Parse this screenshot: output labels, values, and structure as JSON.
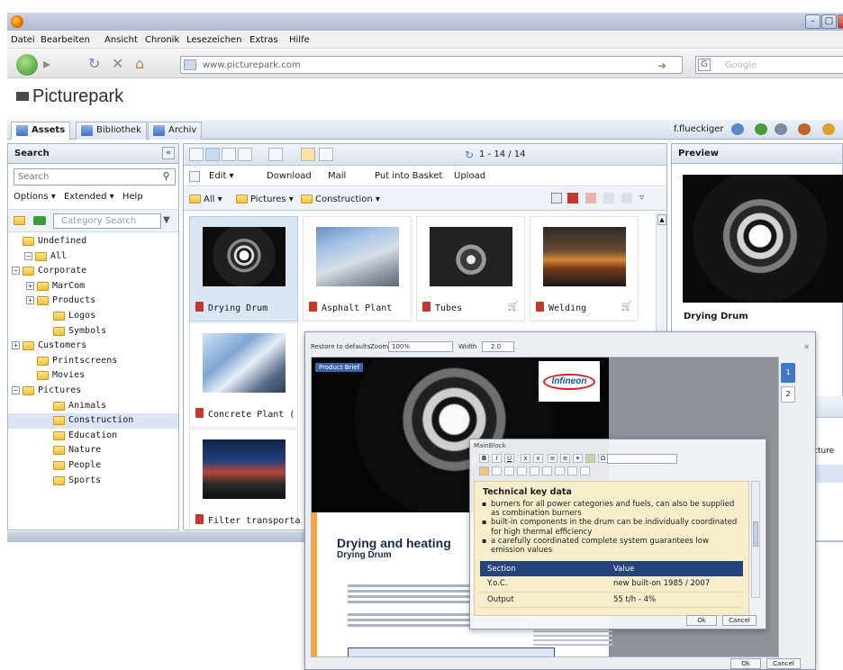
{
  "browser": {
    "menu": [
      "Datei",
      "Bearbeiten",
      "Ansicht",
      "Chronik",
      "Lesezeichen",
      "Extras",
      "Hilfe"
    ],
    "url": "www.picturepark.com",
    "search_engine": "Google"
  },
  "app": {
    "logo_text": "Picturepark",
    "tabs": [
      "Assets",
      "Bibliothek",
      "Archiv"
    ],
    "user": "f.flueckiger"
  },
  "left": {
    "title": "Search",
    "search_placeholder": "Search",
    "options": [
      "Options ▾",
      "Extended ▾",
      "Help"
    ],
    "category_placeholder": "Category Search",
    "tree": [
      {
        "label": "Undefined",
        "depth": 1,
        "toggle": ""
      },
      {
        "label": "All",
        "depth": 0,
        "toggle": "−",
        "open": true
      },
      {
        "label": "Corporate",
        "depth": 1,
        "toggle": "−",
        "open": true
      },
      {
        "label": "MarCom",
        "depth": 2,
        "toggle": "+"
      },
      {
        "label": "Products",
        "depth": 2,
        "toggle": "+"
      },
      {
        "label": "Logos",
        "depth": 3,
        "toggle": ""
      },
      {
        "label": "Symbols",
        "depth": 3,
        "toggle": ""
      },
      {
        "label": "Customers",
        "depth": 1,
        "toggle": "+"
      },
      {
        "label": "Printscreens",
        "depth": 2,
        "toggle": ""
      },
      {
        "label": "Movies",
        "depth": 2,
        "toggle": ""
      },
      {
        "label": "Pictures",
        "depth": 1,
        "toggle": "−",
        "open": true
      },
      {
        "label": "Animals",
        "depth": 3,
        "toggle": ""
      },
      {
        "label": "Construction",
        "depth": 3,
        "toggle": "",
        "selected": true
      },
      {
        "label": "Education",
        "depth": 3,
        "toggle": ""
      },
      {
        "label": "Nature",
        "depth": 3,
        "toggle": ""
      },
      {
        "label": "People",
        "depth": 3,
        "toggle": ""
      },
      {
        "label": "Sports",
        "depth": 3,
        "toggle": ""
      }
    ]
  },
  "center": {
    "paging": "1 - 14 / 14",
    "actions": [
      "Edit ▾",
      "Download",
      "Mail",
      "Put into Basket",
      "Upload"
    ],
    "crumbs": [
      "All ▾",
      "Pictures ▾",
      "Construction ▾"
    ],
    "assets": [
      {
        "label": "Drying Drum",
        "thumb": "drum",
        "selected": true,
        "cart": false
      },
      {
        "label": "Asphalt Plant",
        "thumb": "asphalt",
        "selected": false,
        "cart": false
      },
      {
        "label": "Tubes",
        "thumb": "tubes",
        "selected": false,
        "cart": true
      },
      {
        "label": "Welding",
        "thumb": "welding",
        "selected": false,
        "cart": true
      },
      {
        "label": "Concrete Plant (",
        "thumb": "concrete",
        "selected": false,
        "cart": false
      },
      {
        "label": "Filter transporta",
        "thumb": "filter",
        "selected": false,
        "cart": false
      }
    ]
  },
  "preview": {
    "title": "Preview",
    "asset_title": "Drying Drum"
  },
  "overlay": {
    "restore_label": "Restore to defaults",
    "zoom_label": "Zoom",
    "zoom_value": "100%",
    "width_label": "Width",
    "width_value": "2.0",
    "product_brief": "Product Brief",
    "brand": "Infineon",
    "doc_title": "Drying and heating",
    "doc_subtitle": "Drying Drum",
    "ok": "Ok",
    "cancel": "Cancel",
    "behind_text": "cture"
  },
  "keydata": {
    "window_title": "MainBlock",
    "heading": "Technical key data",
    "bullets": [
      "burners for all power categories and fuels, can also be supplied as combination burners",
      "built-in components in the drum can be individually coordinated for high thermal efficiency",
      "a carefully coordinated complete system guarantees low emission values"
    ],
    "table_header": [
      "Section",
      "Value"
    ],
    "rows": [
      [
        "Y.o.C.",
        "new built-on 1985 / 2007"
      ],
      [
        "Output",
        "55 t/h - 4%"
      ]
    ],
    "ok": "Ok",
    "cancel": "Cancel"
  }
}
